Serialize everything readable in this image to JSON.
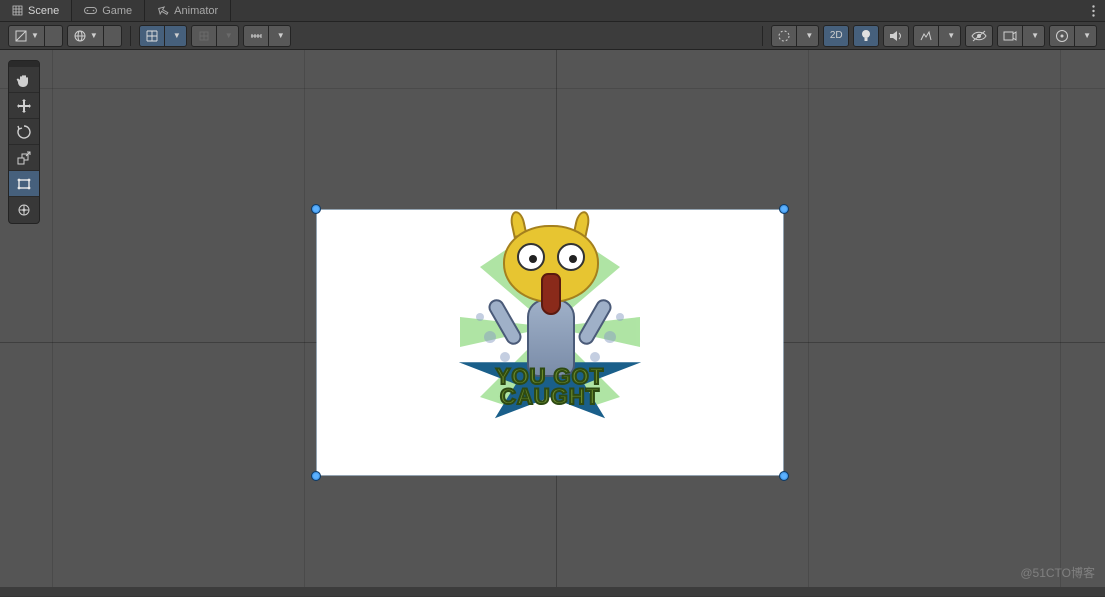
{
  "tabs": [
    {
      "label": "Scene",
      "icon": "grid-icon",
      "active": true
    },
    {
      "label": "Game",
      "icon": "gamepad-icon",
      "active": false
    },
    {
      "label": "Animator",
      "icon": "animator-icon",
      "active": false
    }
  ],
  "toolbar_left": {
    "shading_mode": "Shaded",
    "draw_mode": "2D"
  },
  "toolbar_overlay": {
    "grid_toggle_active": true,
    "snap_label": "",
    "increment_label": ""
  },
  "toolbar_right": {
    "mode_2d": "2D",
    "gizmo_dropdown": ""
  },
  "tools": [
    {
      "name": "view-tool",
      "icon": "hand-icon"
    },
    {
      "name": "move-tool",
      "icon": "move-icon"
    },
    {
      "name": "rotate-tool",
      "icon": "rotate-icon"
    },
    {
      "name": "scale-tool",
      "icon": "scale-icon"
    },
    {
      "name": "rect-tool",
      "icon": "rect-icon",
      "active": true
    },
    {
      "name": "transform-tool",
      "icon": "transform-icon"
    }
  ],
  "sprite": {
    "caption_line1": "YOU GOT",
    "caption_line2": "CAUGHT"
  },
  "watermark": "@51CTO博客",
  "colors": {
    "accent": "#46607c",
    "bg": "#555555",
    "panel": "#383838"
  }
}
